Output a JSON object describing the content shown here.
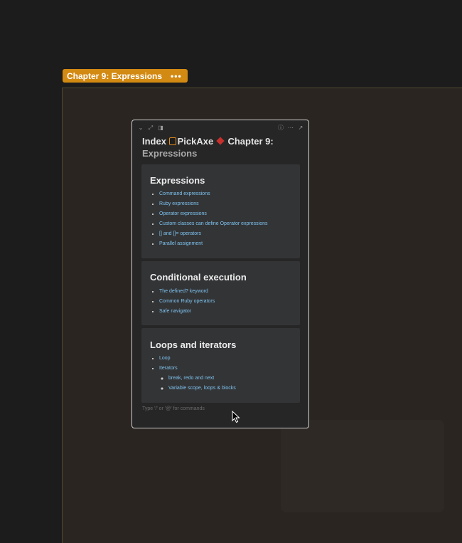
{
  "tag": {
    "label": "Chapter 9: Expressions",
    "more": "•••"
  },
  "card": {
    "title_index": "Index",
    "title_book": "PickAxe",
    "title_chapter": "Chapter 9:",
    "title_rest": "Expressions",
    "toolbar_icons": [
      "chevron-down-icon",
      "expand-icon",
      "sidebar-icon",
      "info-icon",
      "more-icon",
      "open-icon"
    ]
  },
  "sections": [
    {
      "heading": "Expressions",
      "items": [
        "Command expressions",
        "Ruby expressions",
        "Operator expressions",
        "Custom classes can define Operator expressions",
        "[] and []= operators",
        "Parallel assignment"
      ]
    },
    {
      "heading": "Conditional execution",
      "items": [
        "The defined? keyword",
        "Common Ruby operators",
        "Safe navigator"
      ]
    },
    {
      "heading": "Loops and iterators",
      "items": [
        "Loop",
        "Iterators"
      ],
      "subitems": [
        "break, redo and next",
        "Variable scope, loops & blocks"
      ]
    }
  ],
  "footer_hint": "Type '/' or '@' for commands",
  "colors": {
    "tag": "#d38a12",
    "link": "#7ec3ef",
    "canvas": "#2a2521"
  }
}
